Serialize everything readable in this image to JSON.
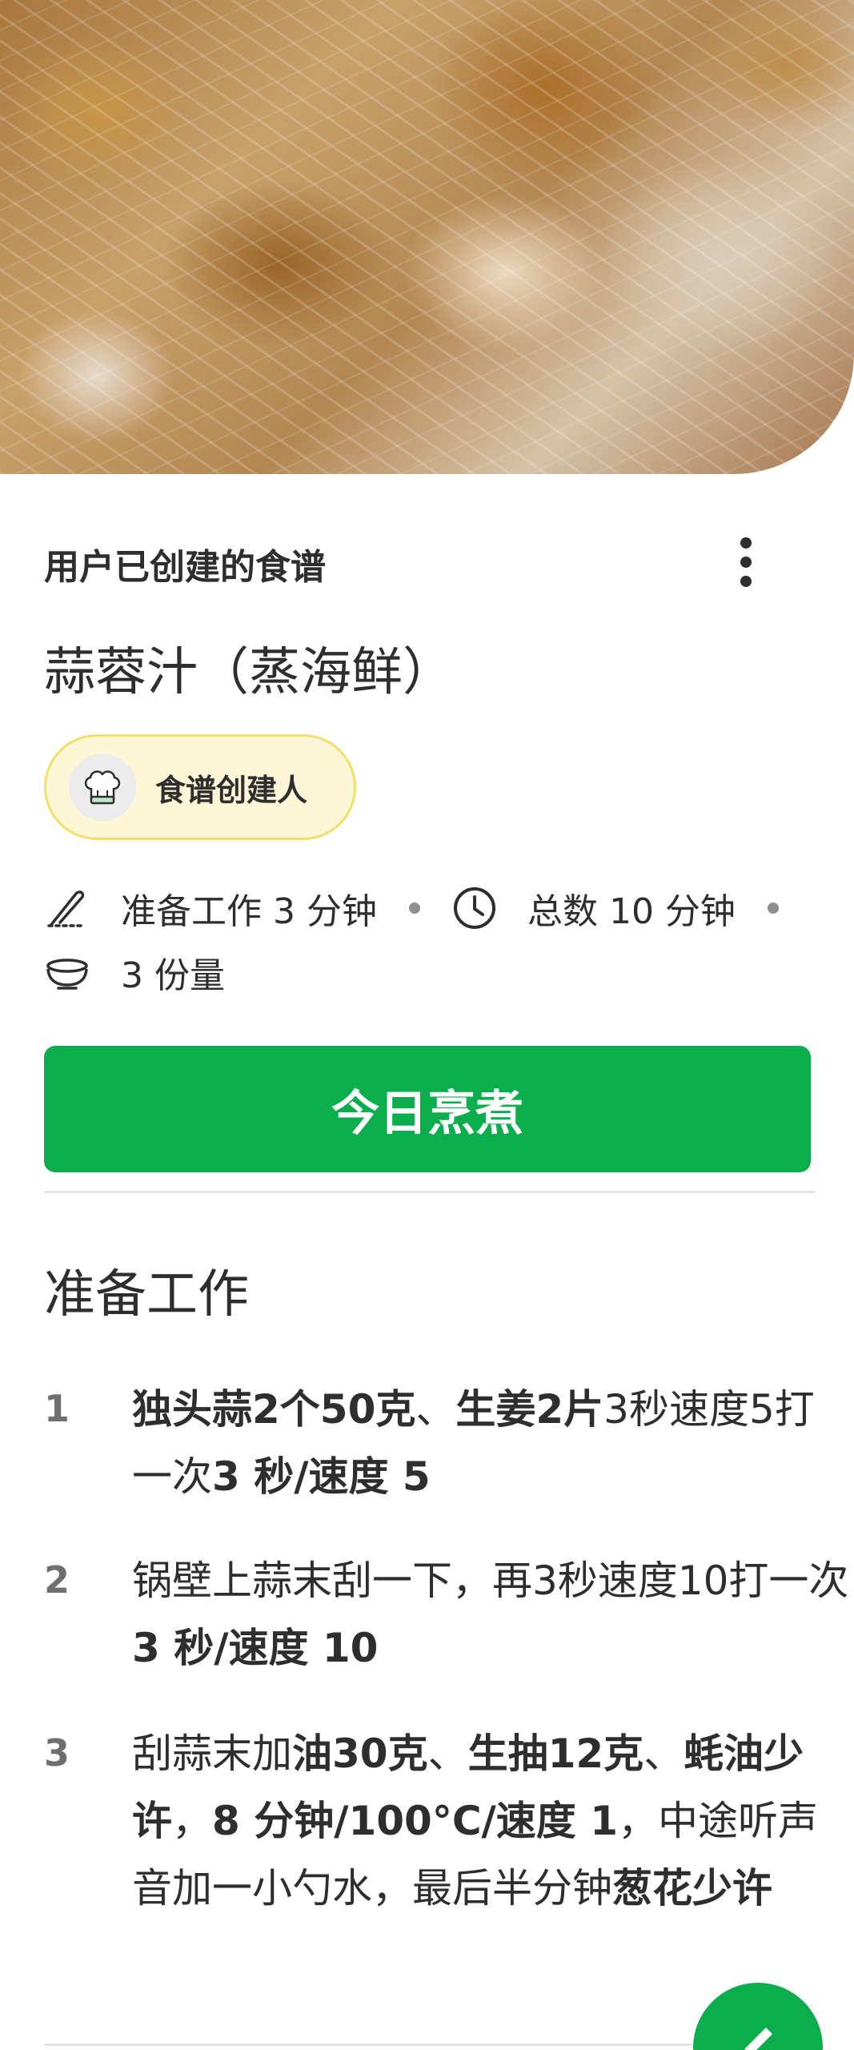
{
  "hero": {
    "image": "steamed-garlic-seafood-photo"
  },
  "header": {
    "section_label": "用户已创建的食谱",
    "more_icon": "more-vert-icon"
  },
  "recipe": {
    "title": "蒜蓉汁（蒸海鲜）",
    "creator_label": "食谱创建人",
    "prep_time": "准备工作 3 分钟",
    "total_time": "总数 10 分钟",
    "servings": "3 份量"
  },
  "actions": {
    "cook_today": "今日烹煮"
  },
  "preparation": {
    "heading": "准备工作",
    "steps": [
      {
        "number": "1",
        "parts": [
          {
            "text": "独头蒜2个50克",
            "bold": true
          },
          {
            "text": "、",
            "bold": false
          },
          {
            "text": "生姜2片",
            "bold": true
          },
          {
            "text": "3秒速度5打一次",
            "bold": false
          },
          {
            "text": "3 秒/速度 5",
            "bold": true
          }
        ]
      },
      {
        "number": "2",
        "parts": [
          {
            "text": "锅壁上蒜末刮一下，再3秒速度10打一次",
            "bold": false
          },
          {
            "text": "3 秒/速度 10",
            "bold": true
          }
        ]
      },
      {
        "number": "3",
        "parts": [
          {
            "text": "刮蒜末加",
            "bold": false
          },
          {
            "text": "油30克",
            "bold": true
          },
          {
            "text": "、",
            "bold": false
          },
          {
            "text": "生抽12克",
            "bold": true
          },
          {
            "text": "、",
            "bold": false
          },
          {
            "text": "蚝油少许",
            "bold": true
          },
          {
            "text": "，",
            "bold": false
          },
          {
            "text": "8 分钟/100°C/速度 1",
            "bold": true
          },
          {
            "text": "，中途听声音加一小勺水，最后半分钟",
            "bold": false
          },
          {
            "text": "葱花少许",
            "bold": true
          }
        ]
      }
    ]
  },
  "icons": {
    "prep": "prep-knife-icon",
    "clock": "clock-icon",
    "servings": "bowl-icon",
    "chef": "chef-hat-icon",
    "fab": "edit-pencil-icon"
  },
  "colors": {
    "primary_green": "#0bad4c",
    "chip_bg": "#fdf7d8",
    "chip_border": "#f0e06a",
    "text": "#2e2e2e"
  }
}
